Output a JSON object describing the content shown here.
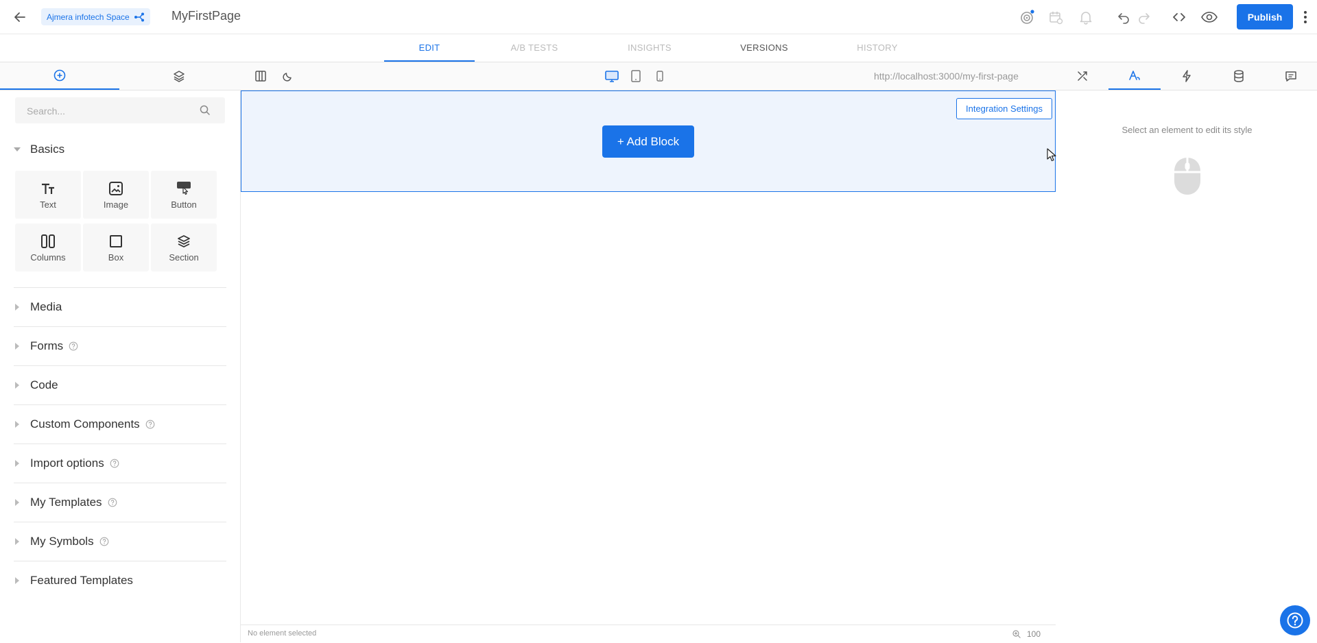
{
  "topbar": {
    "space_label": "Ajmera infotech Space",
    "page_name": "MyFirstPage",
    "publish_label": "Publish"
  },
  "main_tabs": [
    {
      "label": "EDIT",
      "state": "active"
    },
    {
      "label": "A/B TESTS",
      "state": "disabled"
    },
    {
      "label": "INSIGHTS",
      "state": "disabled"
    },
    {
      "label": "VERSIONS",
      "state": "normal"
    },
    {
      "label": "HISTORY",
      "state": "disabled"
    }
  ],
  "toolbar": {
    "url": "http://localhost:3000/my-first-page"
  },
  "left_panel": {
    "search_placeholder": "Search...",
    "basics_label": "Basics",
    "blocks": [
      {
        "label": "Text",
        "icon": "text-icon"
      },
      {
        "label": "Image",
        "icon": "image-icon"
      },
      {
        "label": "Button",
        "icon": "button-icon"
      },
      {
        "label": "Columns",
        "icon": "columns-icon"
      },
      {
        "label": "Box",
        "icon": "box-icon"
      },
      {
        "label": "Section",
        "icon": "section-icon"
      }
    ],
    "categories": [
      {
        "label": "Media",
        "help": false
      },
      {
        "label": "Forms",
        "help": true
      },
      {
        "label": "Code",
        "help": false
      },
      {
        "label": "Custom Components",
        "help": true
      },
      {
        "label": "Import options",
        "help": true
      },
      {
        "label": "My Templates",
        "help": true
      },
      {
        "label": "My Symbols",
        "help": true
      },
      {
        "label": "Featured Templates",
        "help": false
      }
    ]
  },
  "canvas": {
    "integration_label": "Integration Settings",
    "add_block_label": "+ Add Block",
    "status_text": "No element selected",
    "zoom": "100"
  },
  "right_panel": {
    "hint": "Select an element to edit its style"
  },
  "colors": {
    "accent": "#1a73e8",
    "block_bg": "#eef4fd"
  }
}
